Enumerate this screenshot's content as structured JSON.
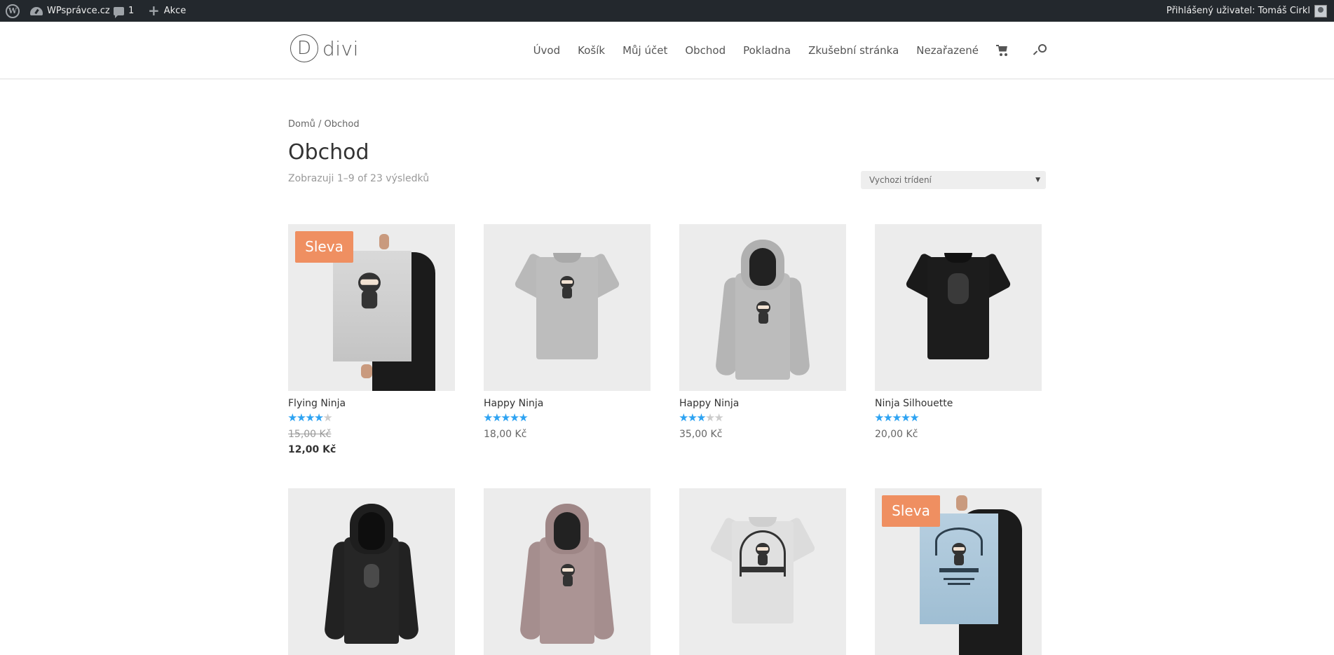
{
  "adminbar": {
    "site_name": "WPsprávce.cz",
    "comments_count": "1",
    "new_label": "Akce",
    "user_label": "Přihlášený uživatel: Tomáš Cirkl"
  },
  "header": {
    "logo_letter": "D",
    "logo_text": "divi",
    "nav": [
      "Úvod",
      "Košík",
      "Můj účet",
      "Obchod",
      "Pokladna",
      "Zkušební stránka",
      "Nezařazené"
    ]
  },
  "breadcrumb": "Domů / Obchod",
  "page_title": "Obchod",
  "result_count": "Zobrazuji 1–9 of 23 výsledků",
  "ordering": {
    "selected": "Vychozi trídení"
  },
  "sale_label": "Sleva",
  "products": [
    {
      "name": "Flying Ninja",
      "rating": 4,
      "old_price": "15,00 Kč",
      "price": "12,00 Kč",
      "sale": true,
      "image": "poster"
    },
    {
      "name": "Happy Ninja",
      "rating": 5,
      "price": "18,00 Kč",
      "sale": false,
      "image": "tshirt-grey"
    },
    {
      "name": "Happy Ninja",
      "rating": 3,
      "price": "35,00 Kč",
      "sale": false,
      "image": "hoodie-grey"
    },
    {
      "name": "Ninja Silhouette",
      "rating": 5,
      "price": "20,00 Kč",
      "sale": false,
      "image": "tshirt-black"
    },
    {
      "image": "hoodie-black",
      "sale": false
    },
    {
      "image": "hoodie-pink",
      "sale": false
    },
    {
      "image": "tshirt-woo",
      "sale": false
    },
    {
      "image": "poster-woo",
      "sale": true
    }
  ],
  "colors": {
    "accent": "#2ea3f2",
    "sale": "#ef8f61",
    "adminbar": "#23282d"
  }
}
